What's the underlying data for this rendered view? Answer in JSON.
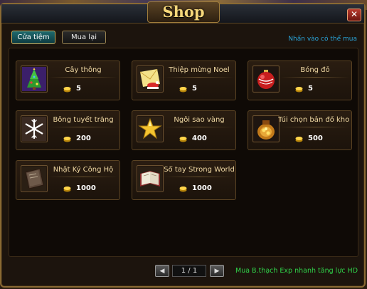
{
  "window": {
    "title": "Shop",
    "close_label": "✕"
  },
  "tabs": [
    {
      "label": "Cửa tiệm",
      "active": true
    },
    {
      "label": "Mua lại",
      "active": false
    }
  ],
  "hint_top": "Nhấn vào có thể mua",
  "items": [
    {
      "name": "Cây thông",
      "price": "5",
      "icon": "christmas-tree-icon"
    },
    {
      "name": "Thiệp mừng Noel",
      "price": "5",
      "icon": "greeting-card-icon"
    },
    {
      "name": "Bóng đỏ",
      "price": "5",
      "icon": "red-ornament-icon"
    },
    {
      "name": "Bông tuyết trắng",
      "price": "200",
      "icon": "snowflake-icon"
    },
    {
      "name": "Ngôi sao vàng",
      "price": "400",
      "icon": "gold-star-icon"
    },
    {
      "name": "Túi chọn bản đồ kho báu",
      "price": "500",
      "icon": "treasure-bag-icon"
    },
    {
      "name": "Nhật Ký Công Hộ",
      "price": "1000",
      "icon": "diary-icon"
    },
    {
      "name": "Sổ tay Strong World",
      "price": "1000",
      "icon": "notebook-icon"
    }
  ],
  "pagination": {
    "text": "1 / 1",
    "prev": "◀",
    "next": "▶"
  },
  "promo": "Mua B.thạch Exp nhanh tăng lực HD",
  "colors": {
    "gold": "#f6d77a",
    "hint_blue": "#2aa4d8",
    "promo_green": "#2fd34a"
  }
}
